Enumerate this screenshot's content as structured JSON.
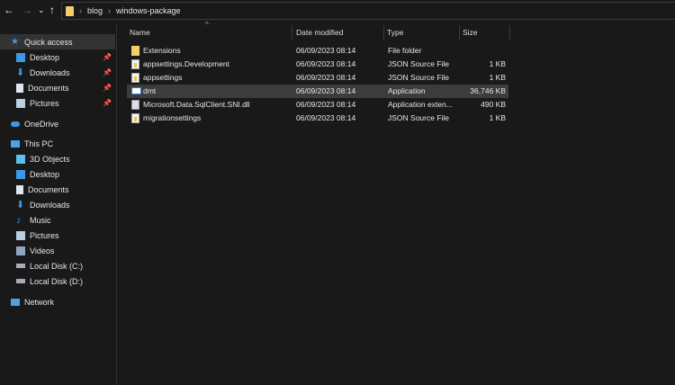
{
  "toolbar": {
    "back": "←",
    "forward": "→",
    "recent": "⌄",
    "up": "↑"
  },
  "breadcrumb": [
    "blog",
    "windows-package"
  ],
  "sidebar": {
    "quick_access": "Quick access",
    "quick_items": [
      "Desktop",
      "Downloads",
      "Documents",
      "Pictures"
    ],
    "onedrive": "OneDrive",
    "this_pc": "This PC",
    "pc_items": [
      "3D Objects",
      "Desktop",
      "Documents",
      "Downloads",
      "Music",
      "Pictures",
      "Videos",
      "Local Disk (C:)",
      "Local Disk (D:)"
    ],
    "network": "Network"
  },
  "columns": {
    "name": "Name",
    "date": "Date modified",
    "type": "Type",
    "size": "Size"
  },
  "files": [
    {
      "name": "Extensions",
      "date": "06/09/2023 08:14",
      "type": "File folder",
      "size": "",
      "icon": "folder-icon"
    },
    {
      "name": "appsettings.Development",
      "date": "06/09/2023 08:14",
      "type": "JSON Source File",
      "size": "1 KB",
      "icon": "json-file-icon"
    },
    {
      "name": "appsettings",
      "date": "06/09/2023 08:14",
      "type": "JSON Source File",
      "size": "1 KB",
      "icon": "json-file-icon"
    },
    {
      "name": "dmt",
      "date": "06/09/2023 08:14",
      "type": "Application",
      "size": "36,746 KB",
      "icon": "application-icon"
    },
    {
      "name": "Microsoft.Data.SqlClient.SNI.dll",
      "date": "06/09/2023 08:14",
      "type": "Application exten...",
      "size": "490 KB",
      "icon": "dll-file-icon"
    },
    {
      "name": "migrationsettings",
      "date": "06/09/2023 08:14",
      "type": "JSON Source File",
      "size": "1 KB",
      "icon": "json-file-icon"
    }
  ],
  "colors": {
    "selection": "#3c3c3c",
    "folder": "#f3cf69",
    "accent": "#3a9ae8"
  }
}
